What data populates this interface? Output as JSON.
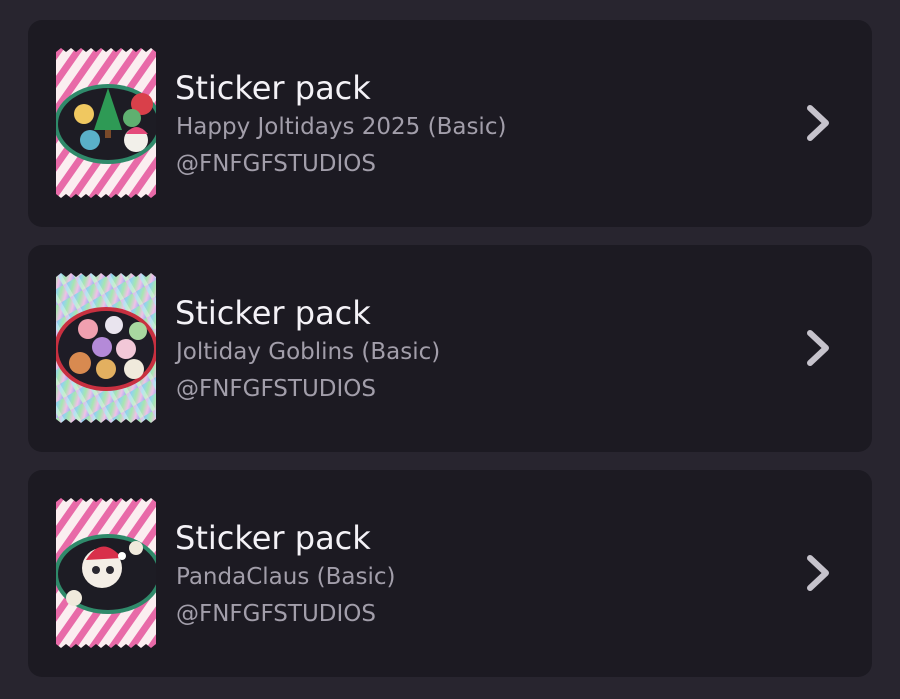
{
  "packs": [
    {
      "title": "Sticker pack",
      "name": "Happy Joltidays 2025 (Basic)",
      "author": "@FNFGFSTUDIOS",
      "thumbnail_icon": "candy-cane-sticker-pack-icon"
    },
    {
      "title": "Sticker pack",
      "name": "Joltiday Goblins (Basic)",
      "author": "@FNFGFSTUDIOS",
      "thumbnail_icon": "holographic-sticker-pack-icon"
    },
    {
      "title": "Sticker pack",
      "name": "PandaClaus (Basic)",
      "author": "@FNFGFSTUDIOS",
      "thumbnail_icon": "candy-cane-sticker-pack-icon"
    }
  ],
  "chevron_icon": "chevron-right-icon",
  "colors": {
    "background": "#28252f",
    "card": "#1c1a22",
    "title": "#f4f2f7",
    "secondary_text": "#a29eaa"
  }
}
